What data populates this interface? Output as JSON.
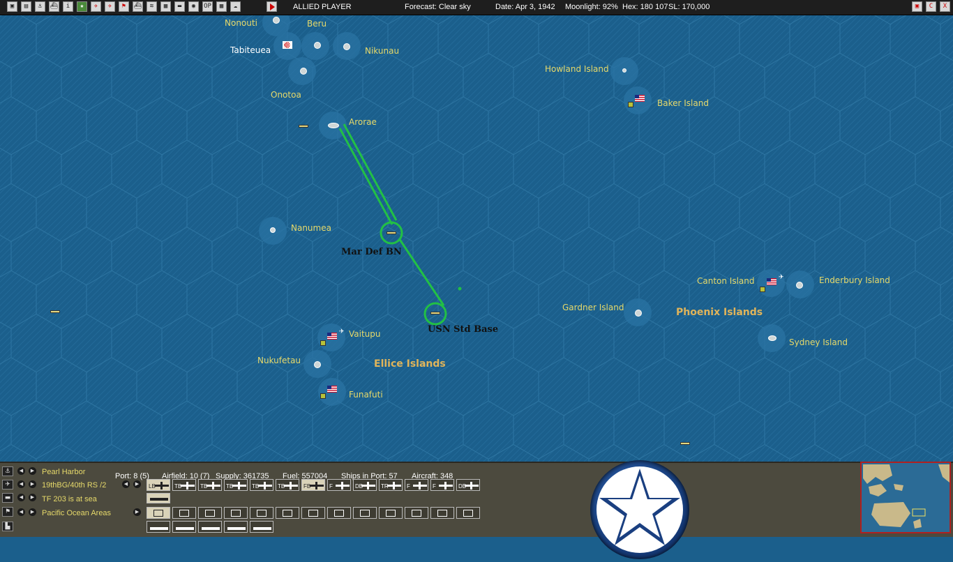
{
  "topbar": {
    "buttons": [
      {
        "name": "units-list",
        "glyph": "▣"
      },
      {
        "name": "reports",
        "glyph": "▤"
      },
      {
        "name": "bases",
        "glyph": "⚓"
      },
      {
        "name": "task-forces",
        "glyph": "⛴"
      },
      {
        "name": "info",
        "glyph": "i"
      },
      {
        "name": "victory",
        "glyph": "★"
      },
      {
        "name": "air-groups",
        "glyph": "✈"
      },
      {
        "name": "aircraft",
        "glyph": "✈"
      },
      {
        "name": "flag",
        "glyph": "⚑"
      },
      {
        "name": "ships",
        "glyph": "⛴"
      },
      {
        "name": "convoy",
        "glyph": "≋"
      },
      {
        "name": "map",
        "glyph": "▦"
      },
      {
        "name": "transport",
        "glyph": "▬"
      },
      {
        "name": "globe",
        "glyph": "◉"
      },
      {
        "name": "op",
        "glyph": "OP"
      },
      {
        "name": "grid",
        "glyph": "▦"
      },
      {
        "name": "weather",
        "glyph": "☁"
      }
    ],
    "side": "ALLIED PLAYER",
    "forecast": "Forecast: Clear sky",
    "date": "Date: Apr 3, 1942",
    "moonlight": "Moonlight: 92%",
    "hex": "Hex: 180 107",
    "sl": "SL: 170,000",
    "right_buttons": [
      "▣",
      "C",
      "X"
    ]
  },
  "map": {
    "places": [
      {
        "id": "nonouti",
        "name": "Nonouti"
      },
      {
        "id": "beru",
        "name": "Beru"
      },
      {
        "id": "tabiteuea",
        "name": "Tabiteuea"
      },
      {
        "id": "nikunau",
        "name": "Nikunau"
      },
      {
        "id": "onotoa",
        "name": "Onotoa"
      },
      {
        "id": "arorae",
        "name": "Arorae"
      },
      {
        "id": "howland",
        "name": "Howland Island"
      },
      {
        "id": "baker",
        "name": "Baker Island"
      },
      {
        "id": "nanumea",
        "name": "Nanumea"
      },
      {
        "id": "canton",
        "name": "Canton Island"
      },
      {
        "id": "enderbury",
        "name": "Enderbury Island"
      },
      {
        "id": "gardner",
        "name": "Gardner Island"
      },
      {
        "id": "vaitupu",
        "name": "Vaitupu"
      },
      {
        "id": "nukufetau",
        "name": "Nukufetau"
      },
      {
        "id": "sydney",
        "name": "Sydney Island"
      },
      {
        "id": "funafuti",
        "name": "Funafuti"
      }
    ],
    "regions": [
      {
        "id": "phoenix",
        "name": "Phoenix Islands"
      },
      {
        "id": "ellice",
        "name": "Ellice Islands"
      }
    ],
    "units": [
      {
        "id": "mar-def-bn",
        "name": "Mar Def BN"
      },
      {
        "id": "usn-std-base",
        "name": "USN Std Base"
      }
    ],
    "route_color": "#22c045"
  },
  "panel": {
    "rows": [
      {
        "label": "Pearl Harbor"
      },
      {
        "label": "19thBG/40th RS /2"
      },
      {
        "label": "TF 203 is at sea"
      },
      {
        "label": "Pacific Ocean Areas"
      }
    ],
    "stats": {
      "port": "Port: 8 (5)",
      "airfield": "Airfield: 10 (7)",
      "supply": "Supply: 361735",
      "fuel": "Fuel: 557004",
      "ships_in_port": "Ships in Port: 57",
      "aircraft": "Aircraft: 348"
    },
    "air_groups": [
      "LB",
      "TB",
      "TB",
      "TB",
      "TB",
      "TB",
      "FB",
      "F",
      "DB",
      "TR",
      "F",
      "F",
      "DB"
    ],
    "label_color": "#e6d96a"
  }
}
